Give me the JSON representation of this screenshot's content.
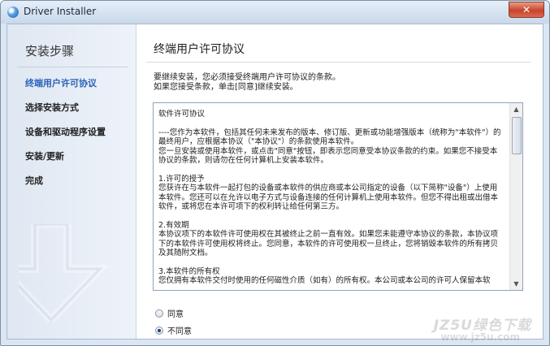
{
  "window": {
    "title": "Driver Installer",
    "close_glyph": "✕",
    "icon": "app-icon"
  },
  "sidebar": {
    "title": "安装步骤",
    "steps": [
      {
        "label": "终端用户许可协议",
        "active": true
      },
      {
        "label": "选择安装方式",
        "active": false
      },
      {
        "label": "设备和驱动程序设置",
        "active": false
      },
      {
        "label": "安装/更新",
        "active": false
      },
      {
        "label": "完成",
        "active": false
      }
    ]
  },
  "main": {
    "page_title": "终端用户许可协议",
    "intro_line1": "要继续安装，您必须接受终端用户许可协议的条款。",
    "intro_line2": "如果您接受条款，单击[同意]继续安装。",
    "license": {
      "heading": "软件许可协议",
      "p1": "----您作为本软件，包括其任何未来发布的版本、修订版、更新或功能增强版本（统称为\"本软件\"）的最终用户，应根据本协议（\"本协议\"）的条款使用本软件。\n您一旦安装或使用本软件，或点击\"同意\"按钮，即表示您同意受本协议条款的约束。如果您不接受本协议的条款，则请勿在任何计算机上安装本软件。",
      "p2": "1.许可的授予\n您获许在与本软件一起打包的设备或本软件的供应商或本公司指定的设备（以下简称\"设备\"）上使用本软件。您还可以在允许以电子方式与设备连接的任何计算机上使用本软件。但您不得出租或出借本软件，或将您在本许可项下的权利转让给任何第三方。",
      "p3": "2.有效期\n本协议项下的本软件许可使用权在其被终止之前一直有效。如果您未能遵守本协议的条款，本协议项下的本软件许可使用权将终止。您同意，本软件的许可使用权一旦终止，您将销毁本软件的所有拷贝及其随附文档。",
      "p4": "3.本软件的所有权\n您仅拥有本软件交付时使用的任何磁性介质（如有）的所有权。本公司或本公司的许可人保留本软"
    },
    "options": {
      "agree": "同意",
      "disagree": "不同意",
      "selected": "disagree"
    }
  },
  "watermark": {
    "line1": "JZ5U绿色下载",
    "line2": "www.jz5u.com"
  }
}
